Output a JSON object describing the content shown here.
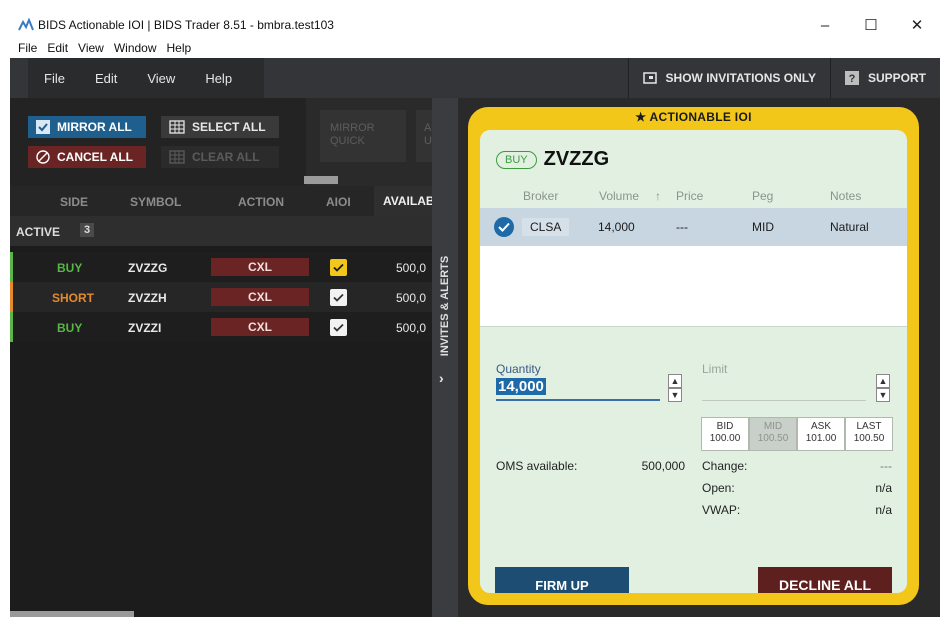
{
  "window": {
    "title": "BIDS Actionable IOI | BIDS Trader 8.51 - bmbra.test103",
    "minimize": "–",
    "maximize": "☐",
    "close": "✕",
    "menu": [
      "File",
      "Edit",
      "View",
      "Window",
      "Help"
    ]
  },
  "appmenu": {
    "items": [
      "File",
      "Edit",
      "View",
      "Help"
    ],
    "show_invitations": "SHOW INVITATIONS ONLY",
    "support": "SUPPORT"
  },
  "blotter": {
    "mirror_all": "MIRROR ALL",
    "select_all": "SELECT ALL",
    "cancel_all": "CANCEL ALL",
    "clear_all": "CLEAR ALL",
    "quick_1": "MIRROR QUICK",
    "quick_2": "AU UI",
    "columns": {
      "side": "SIDE",
      "symbol": "SYMBOL",
      "action": "ACTION",
      "aioi": "AIOI",
      "available": "AVAILABL"
    },
    "active_label": "ACTIVE",
    "active_count": "3",
    "rows": [
      {
        "side": "BUY",
        "side_color": "#59b646",
        "symbol": "ZVZZG",
        "action": "CXL",
        "aioi_checked": true,
        "aioi_highlight": true,
        "available": "500,0"
      },
      {
        "side": "SHORT",
        "side_color": "#e58a2c",
        "symbol": "ZVZZH",
        "action": "CXL",
        "aioi_checked": true,
        "aioi_highlight": false,
        "available": "500,0"
      },
      {
        "side": "BUY",
        "side_color": "#59b646",
        "symbol": "ZVZZI",
        "action": "CXL",
        "aioi_checked": true,
        "aioi_highlight": false,
        "available": "500,0"
      }
    ]
  },
  "invites_tab": "INVITES & ALERTS",
  "ioi": {
    "header": "★ ACTIONABLE IOI",
    "side": "BUY",
    "symbol": "ZVZZG",
    "columns": {
      "broker": "Broker",
      "volume": "Volume",
      "sort_arrow": "↑",
      "price": "Price",
      "peg": "Peg",
      "notes": "Notes"
    },
    "row": {
      "broker": "CLSA",
      "volume": "14,000",
      "price": "---",
      "peg": "MID",
      "notes": "Natural"
    },
    "quantity_label": "Quantity",
    "quantity": "14,000",
    "limit_label": "Limit",
    "price_buttons": [
      {
        "name": "BID",
        "value": "100.00"
      },
      {
        "name": "MID",
        "value": "100.50"
      },
      {
        "name": "ASK",
        "value": "101.00"
      },
      {
        "name": "LAST",
        "value": "100.50"
      }
    ],
    "oms_label": "OMS available:",
    "oms_value": "500,000",
    "change_label": "Change:",
    "change_value": "---",
    "open_label": "Open:",
    "open_value": "n/a",
    "vwap_label": "VWAP:",
    "vwap_value": "n/a",
    "firm_up": "FIRM UP",
    "decline_all": "DECLINE ALL"
  },
  "colors": {
    "accent_yellow": "#f3c71a",
    "buy_green": "#59b646",
    "short_orange": "#e58a2c",
    "cxl_red": "#6a2424",
    "firm_blue": "#1e4d74"
  }
}
